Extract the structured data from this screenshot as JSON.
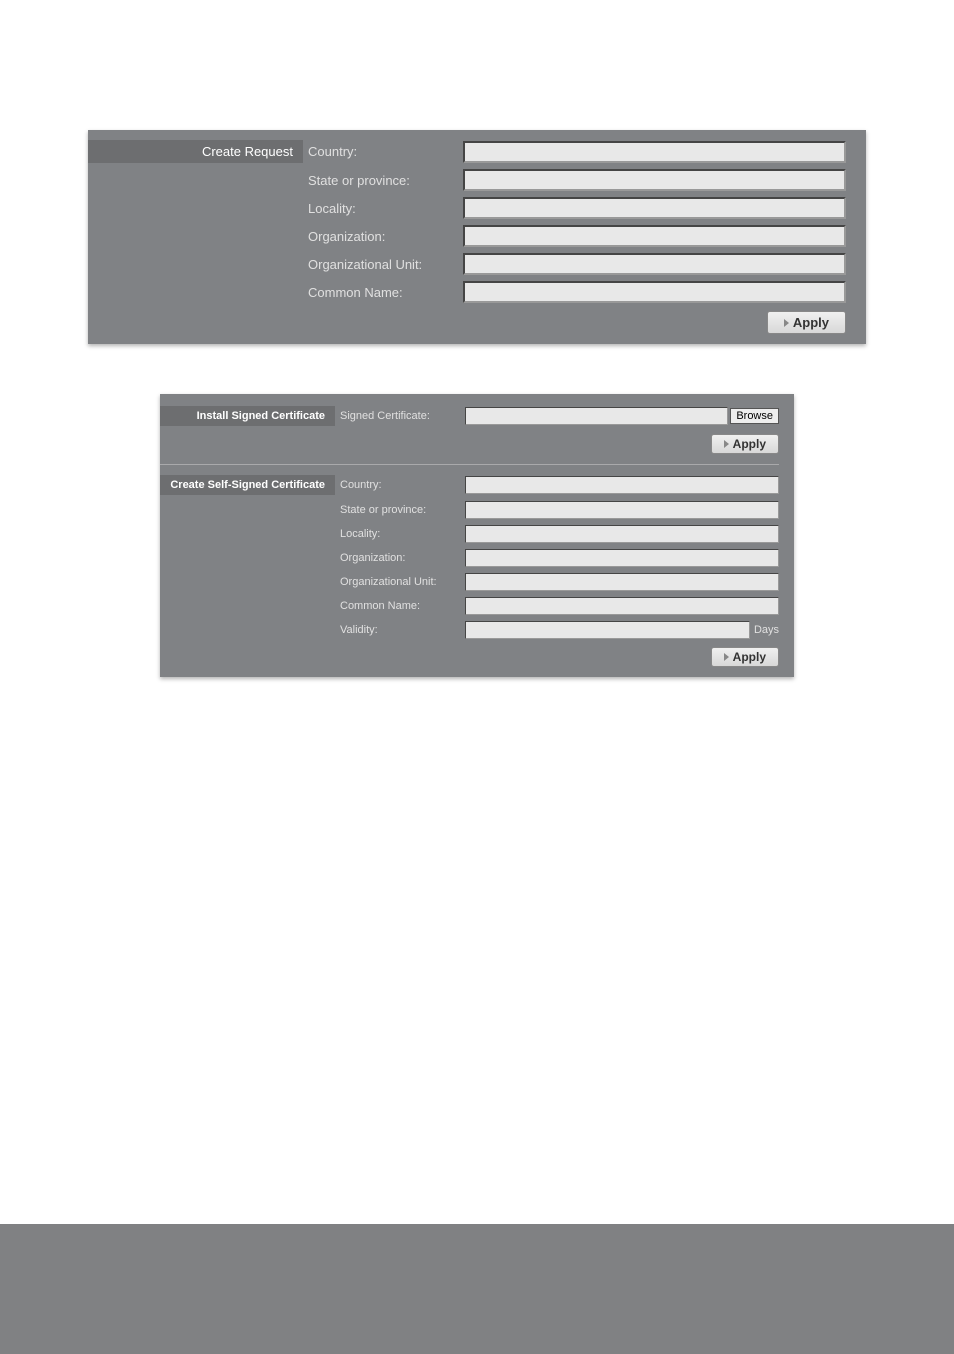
{
  "panel1": {
    "header": "Create Request",
    "fields": {
      "country": "Country:",
      "state": "State or province:",
      "locality": "Locality:",
      "organization": "Organization:",
      "org_unit": "Organizational Unit:",
      "common_name": "Common Name:"
    },
    "apply": "Apply"
  },
  "panel2": {
    "install": {
      "header": "Install Signed Certificate",
      "field_label": "Signed Certificate:",
      "browse": "Browse",
      "apply": "Apply"
    },
    "selfsigned": {
      "header": "Create Self-Signed Certificate",
      "fields": {
        "country": "Country:",
        "state": "State or province:",
        "locality": "Locality:",
        "organization": "Organization:",
        "org_unit": "Organizational Unit:",
        "common_name": "Common Name:",
        "validity": "Validity:"
      },
      "validity_suffix": "Days",
      "apply": "Apply"
    }
  }
}
